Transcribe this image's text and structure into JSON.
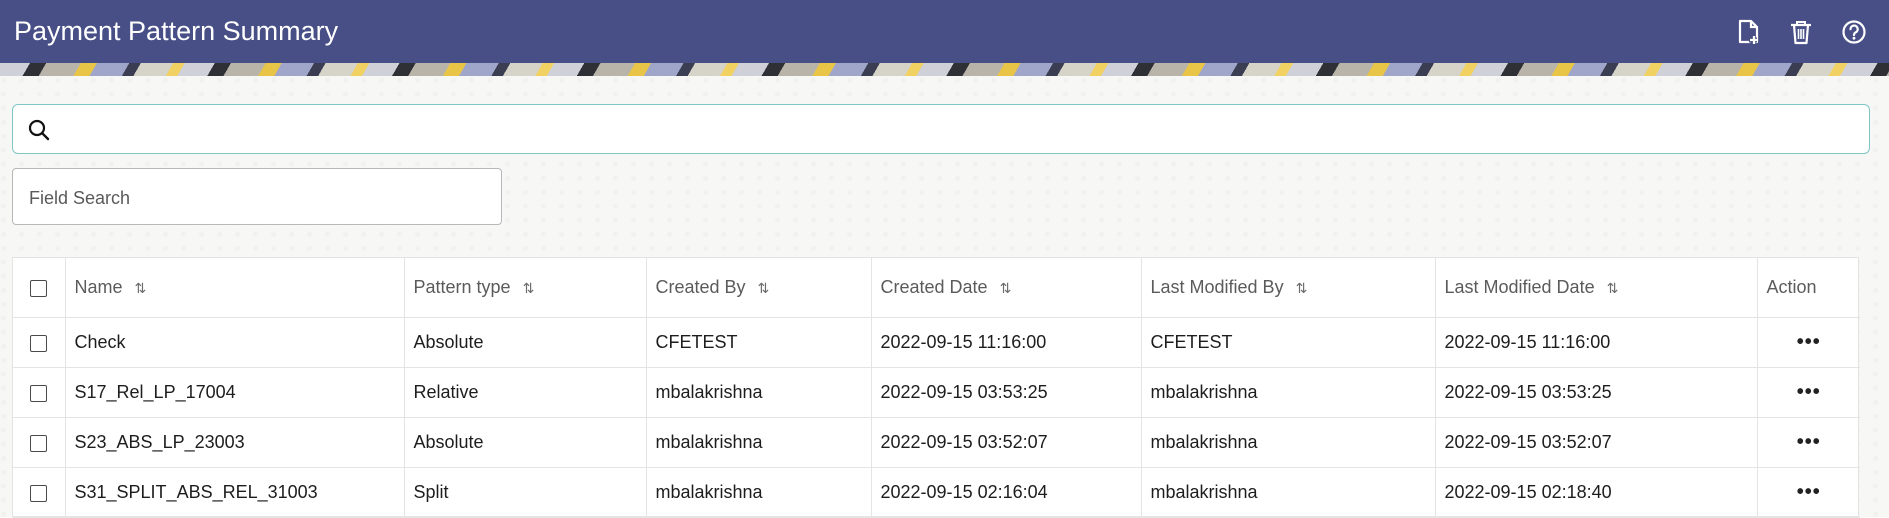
{
  "header": {
    "title": "Payment Pattern Summary",
    "icons": [
      "add-document-icon",
      "delete-icon",
      "help-icon"
    ],
    "bg_color": "#474f86"
  },
  "search": {
    "value": "",
    "placeholder": ""
  },
  "field_search": {
    "placeholder": "Field Search",
    "value": ""
  },
  "table": {
    "columns": [
      "Name",
      "Pattern type",
      "Created By",
      "Created Date",
      "Last Modified By",
      "Last Modified Date",
      "Action"
    ],
    "rows": [
      [
        "Check",
        "Absolute",
        "CFETEST",
        "2022-09-15 11:16:00",
        "CFETEST",
        "2022-09-15 11:16:00"
      ],
      [
        "S17_Rel_LP_17004",
        "Relative",
        "mbalakrishna",
        "2022-09-15 03:53:25",
        "mbalakrishna",
        "2022-09-15 03:53:25"
      ],
      [
        "S23_ABS_LP_23003",
        "Absolute",
        "mbalakrishna",
        "2022-09-15 03:52:07",
        "mbalakrishna",
        "2022-09-15 03:52:07"
      ],
      [
        "S31_SPLIT_ABS_REL_31003",
        "Split",
        "mbalakrishna",
        "2022-09-15 02:16:04",
        "mbalakrishna",
        "2022-09-15 02:18:40"
      ]
    ],
    "sort_glyph": "⇅",
    "action_glyph": "•••"
  }
}
